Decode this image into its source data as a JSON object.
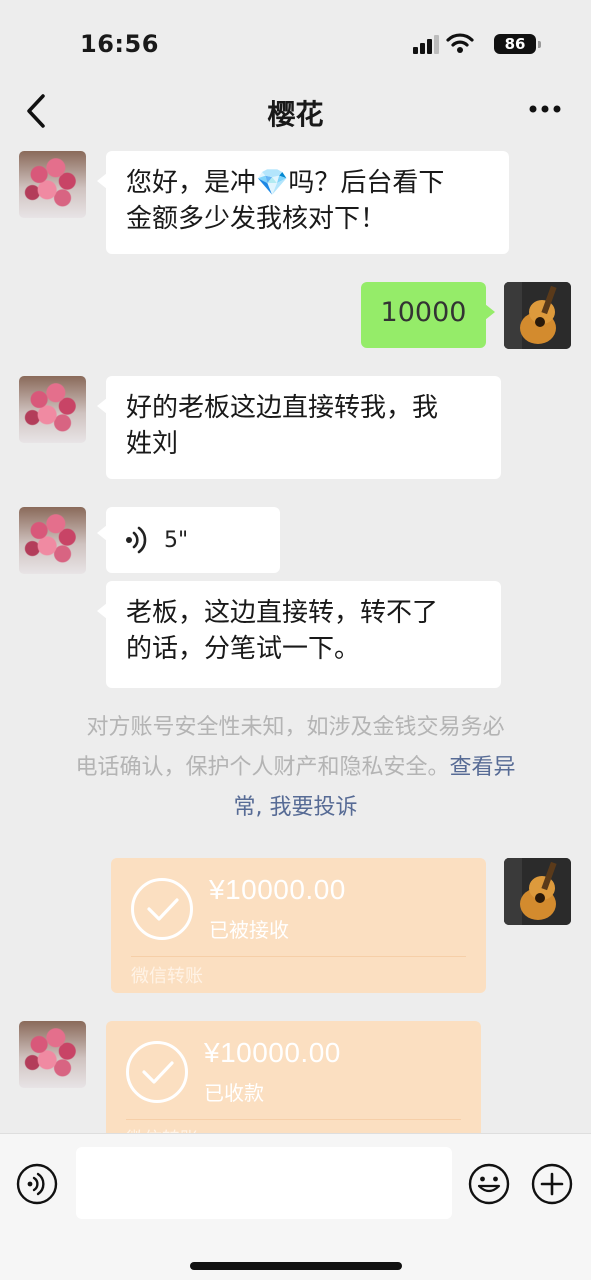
{
  "status_bar": {
    "time": "16:56",
    "battery": "86",
    "icons": [
      "signal-icon",
      "wifi-icon",
      "battery-icon"
    ]
  },
  "nav": {
    "back_icon": "chevron-left-icon",
    "title": "樱花",
    "more_icon": "more-icon"
  },
  "messages": {
    "m1": {
      "sender": "contact",
      "line1": "您好，是冲💎吗？后台看下",
      "line2": "金额多少发我核对下！"
    },
    "m2": {
      "sender": "me",
      "text": "10000"
    },
    "m3": {
      "sender": "contact",
      "line1": "好的老板这边直接转我，我",
      "line2": "姓刘"
    },
    "m4": {
      "sender": "contact",
      "type": "voice",
      "duration": "5\""
    },
    "m5": {
      "sender": "contact",
      "line1": "老板，这边直接转，转不了",
      "line2": "的话，分笔试一下。"
    }
  },
  "notice": {
    "line1": "对方账号安全性未知，如涉及金钱交易务必",
    "line2_text": "电话确认，保护个人财产和隐私安全。",
    "line2_link": "查看异",
    "line3_link_a": "常",
    "line3_sep": ", ",
    "line3_link_b": "我要投诉"
  },
  "transfers": {
    "t1": {
      "sender": "me",
      "amount": "¥10000.00",
      "status": "已被接收",
      "footer": "微信转账"
    },
    "t2": {
      "sender": "contact",
      "amount": "¥10000.00",
      "status": "已收款",
      "footer": "微信转账"
    }
  },
  "input_bar": {
    "icons": [
      "voice-toggle-icon",
      "emoji-icon",
      "plus-icon"
    ],
    "value": ""
  },
  "colors": {
    "background": "#ededed",
    "my_bubble": "#95ec69",
    "their_bubble": "#ffffff",
    "transfer_card": "#fbdfc1",
    "link": "#576b95",
    "notice_text": "#b4b4b4"
  }
}
